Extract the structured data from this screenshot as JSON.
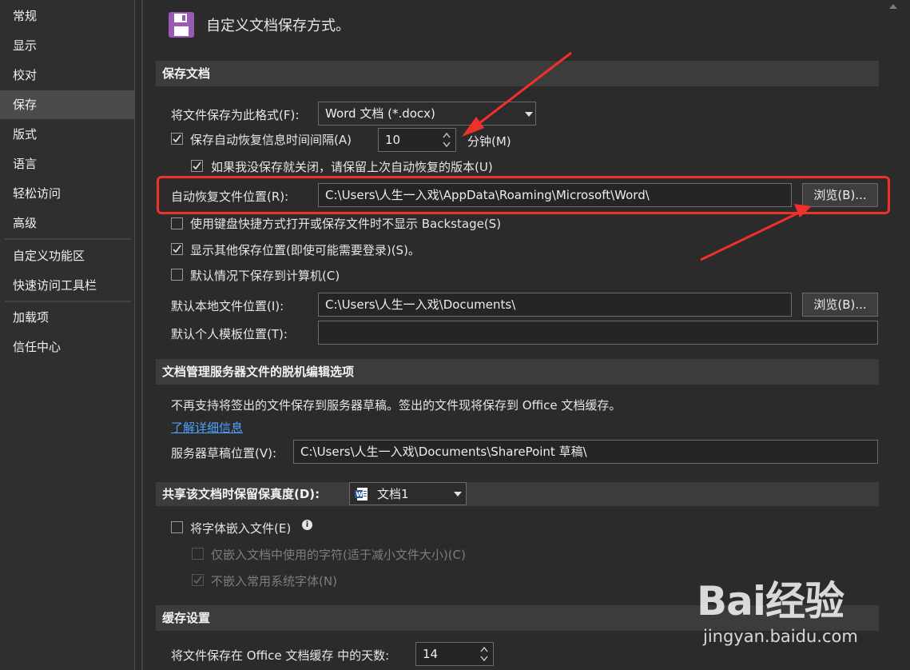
{
  "sidebar": {
    "items": [
      "常规",
      "显示",
      "校对",
      "保存",
      "版式",
      "语言",
      "轻松访问",
      "高级",
      "自定义功能区",
      "快速访问工具栏",
      "加载项",
      "信任中心"
    ],
    "active": "保存"
  },
  "header": {
    "title": "自定义文档保存方式。"
  },
  "save_docs": {
    "section_title": "保存文档",
    "format_label": "将文件保存为此格式(F):",
    "format_value": "Word 文档 (*.docx)",
    "autorecover_label": "保存自动恢复信息时间间隔(A)",
    "autorecover_minutes": "10",
    "minutes_label": "分钟(M)",
    "keep_last_label": "如果我没保存就关闭，请保留上次自动恢复的版本(U)",
    "autorecover_location_label": "自动恢复文件位置(R):",
    "autorecover_location_value": "C:\\Users\\人生一入戏\\AppData\\Roaming\\Microsoft\\Word\\",
    "browse_label": "浏览(B)...",
    "no_backstage_label": "使用键盘快捷方式打开或保存文件时不显示 Backstage(S)",
    "show_other_label": "显示其他保存位置(即使可能需要登录)(S)。",
    "save_to_computer_label": "默认情况下保存到计算机(C)",
    "local_location_label": "默认本地文件位置(I):",
    "local_location_value": "C:\\Users\\人生一入戏\\Documents\\",
    "browse2_label": "浏览(B)...",
    "template_location_label": "默认个人模板位置(T):",
    "template_location_value": ""
  },
  "offline": {
    "section_title": "文档管理服务器文件的脱机编辑选项",
    "notice": "不再支持将签出的文件保存到服务器草稿。签出的文件现将保存到 Office 文档缓存。",
    "learn_more": "了解详细信息",
    "drafts_label": "服务器草稿位置(V):",
    "drafts_value": "C:\\Users\\人生一入戏\\Documents\\SharePoint 草稿\\"
  },
  "fidelity": {
    "section_title": "共享该文档时保留保真度(D):",
    "doc_value": "文档1",
    "embed_fonts_label": "将字体嵌入文件(E)",
    "embed_used_label": "仅嵌入文档中使用的字符(适于减小文件大小)(C)",
    "no_common_label": "不嵌入常用系统字体(N)"
  },
  "cache": {
    "section_title": "缓存设置",
    "days_label": "将文件保存在 Office 文档缓存 中的天数:",
    "days_value": "14"
  },
  "watermark": {
    "main": "Bai经验",
    "sub": "jingyan.baidu.com"
  },
  "colors": {
    "accent_red": "#f2302a",
    "link": "#4ea1ff",
    "save_icon": "#9b59b6"
  }
}
